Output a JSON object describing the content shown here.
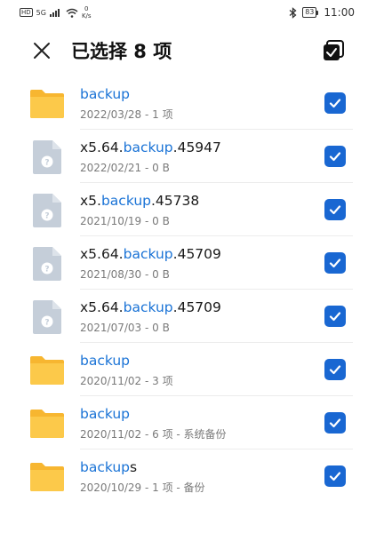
{
  "status_bar": {
    "hd": "HD",
    "network": "5G",
    "speed_value": "0",
    "speed_unit": "K/s",
    "battery": "83",
    "time": "11:00"
  },
  "header": {
    "title": "已选择 8 项"
  },
  "files": [
    {
      "type": "folder",
      "name_pre": "",
      "name_hl": "backup",
      "name_post": "",
      "meta": "2022/03/28 - 1 项",
      "checked": true
    },
    {
      "type": "file",
      "name_pre": "x5.64.",
      "name_hl": "backup",
      "name_post": ".45947",
      "meta": "2022/02/21 - 0 B",
      "checked": true
    },
    {
      "type": "file",
      "name_pre": "x5.",
      "name_hl": "backup",
      "name_post": ".45738",
      "meta": "2021/10/19 - 0 B",
      "checked": true
    },
    {
      "type": "file",
      "name_pre": "x5.64.",
      "name_hl": "backup",
      "name_post": ".45709",
      "meta": "2021/08/30 - 0 B",
      "checked": true
    },
    {
      "type": "file",
      "name_pre": "x5.64.",
      "name_hl": "backup",
      "name_post": ".45709",
      "meta": "2021/07/03 - 0 B",
      "checked": true
    },
    {
      "type": "folder",
      "name_pre": "",
      "name_hl": "backup",
      "name_post": "",
      "meta": "2020/11/02 - 3 项",
      "checked": true
    },
    {
      "type": "folder",
      "name_pre": "",
      "name_hl": "backup",
      "name_post": "",
      "meta": "2020/11/02 - 6 项 - 系统备份",
      "checked": true
    },
    {
      "type": "folder",
      "name_pre": "",
      "name_hl": "backup",
      "name_post": "s",
      "meta": "2020/10/29 - 1 项 - 备份",
      "checked": true
    }
  ],
  "icons": {
    "close": "close-icon",
    "select_all": "select-all-icon",
    "folder": "folder-icon",
    "unknown_file": "unknown-file-icon",
    "check": "check-icon"
  },
  "colors": {
    "accent": "#1967d2",
    "highlight_text": "#1a73d6",
    "folder": "#fbc03d",
    "file_icon": "#c5ced9"
  }
}
